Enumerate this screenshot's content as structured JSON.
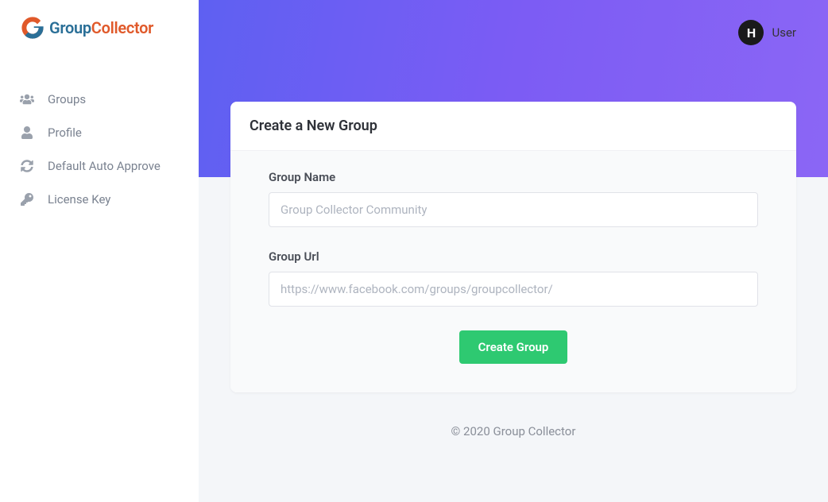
{
  "logo": {
    "part_a": "Group",
    "part_b": "Collector"
  },
  "sidebar": {
    "items": [
      {
        "label": "Groups",
        "icon": "users-icon"
      },
      {
        "label": "Profile",
        "icon": "user-icon"
      },
      {
        "label": "Default Auto Approve",
        "icon": "sync-icon"
      },
      {
        "label": "License Key",
        "icon": "key-icon"
      }
    ]
  },
  "header": {
    "avatar_initial": "H",
    "username": "User"
  },
  "card": {
    "title": "Create a New Group",
    "group_name_label": "Group Name",
    "group_name_placeholder": "Group Collector Community",
    "group_url_label": "Group Url",
    "group_url_placeholder": "https://www.facebook.com/groups/groupcollector/",
    "submit_label": "Create Group"
  },
  "footer": {
    "text": "© 2020 Group Collector"
  }
}
